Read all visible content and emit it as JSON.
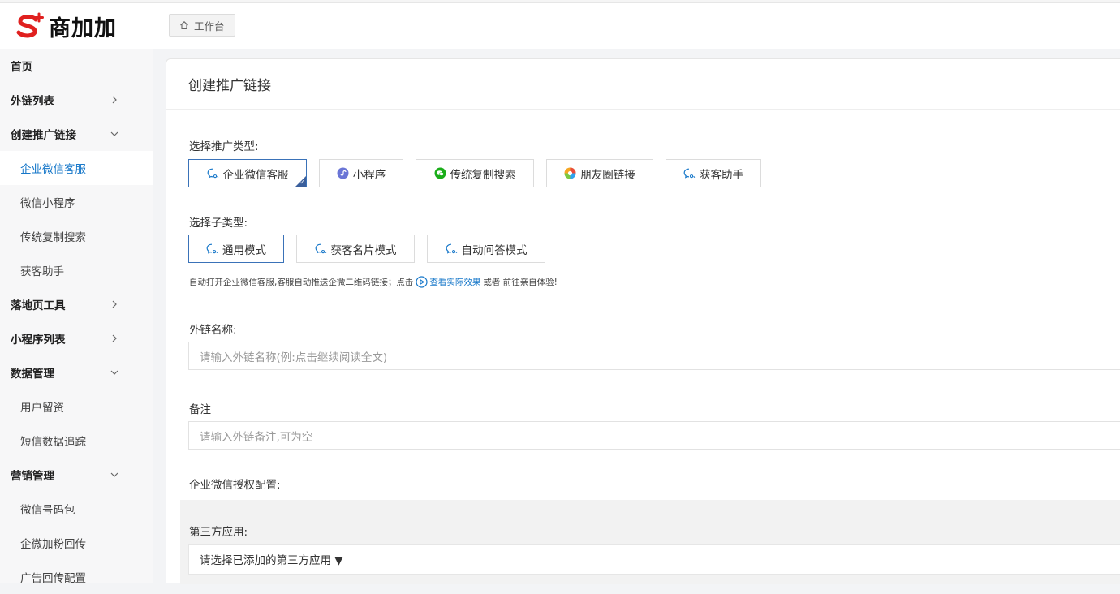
{
  "brand": {
    "name": "商加加",
    "color": "#e0201f"
  },
  "breadcrumb": {
    "label": "工作台"
  },
  "sidebar": {
    "items": [
      {
        "label": "首页",
        "type": "top",
        "chevron": ""
      },
      {
        "label": "外链列表",
        "type": "top",
        "chevron": "right"
      },
      {
        "label": "创建推广链接",
        "type": "top",
        "chevron": "down"
      },
      {
        "label": "企业微信客服",
        "type": "sub",
        "active": true
      },
      {
        "label": "微信小程序",
        "type": "sub"
      },
      {
        "label": "传统复制搜索",
        "type": "sub"
      },
      {
        "label": "获客助手",
        "type": "sub"
      },
      {
        "label": "落地页工具",
        "type": "top",
        "chevron": "right"
      },
      {
        "label": "小程序列表",
        "type": "top",
        "chevron": "right"
      },
      {
        "label": "数据管理",
        "type": "top",
        "chevron": "down"
      },
      {
        "label": "用户留资",
        "type": "sub"
      },
      {
        "label": "短信数据追踪",
        "type": "sub"
      },
      {
        "label": "营销管理",
        "type": "top",
        "chevron": "down"
      },
      {
        "label": "微信号码包",
        "type": "sub"
      },
      {
        "label": "企微加粉回传",
        "type": "sub"
      },
      {
        "label": "广告回传配置",
        "type": "sub"
      }
    ]
  },
  "main": {
    "title": "创建推广链接",
    "promo_type_label": "选择推广类型:",
    "promo_types": [
      {
        "label": "企业微信客服",
        "icon": "wecom-chat-icon",
        "selected": true
      },
      {
        "label": "小程序",
        "icon": "miniprogram-icon"
      },
      {
        "label": "传统复制搜索",
        "icon": "wechat-icon"
      },
      {
        "label": "朋友圈链接",
        "icon": "moments-icon"
      },
      {
        "label": "获客助手",
        "icon": "wecom-chat-icon"
      }
    ],
    "sub_type_label": "选择子类型:",
    "sub_types": [
      {
        "label": "通用模式",
        "selected": true
      },
      {
        "label": "获客名片模式"
      },
      {
        "label": "自动问答模式"
      }
    ],
    "hint": {
      "before": "自动打开企业微信客服,客服自动推送企微二维码链接；点击",
      "link": "查看实际效果",
      "after": "或者 前往亲自体验!"
    },
    "name_label": "外链名称:",
    "name_placeholder": "请输入外链名称(例:点击继续阅读全文)",
    "remark_label": "备注",
    "remark_placeholder": "请输入外链备注,可为空",
    "auth_label": "企业微信授权配置:",
    "third_party_label": "第三方应用:",
    "third_party_select": "请选择已添加的第三方应用 ▼"
  },
  "colors": {
    "accent": "#1677c9",
    "selected_border": "#3a72b8"
  }
}
